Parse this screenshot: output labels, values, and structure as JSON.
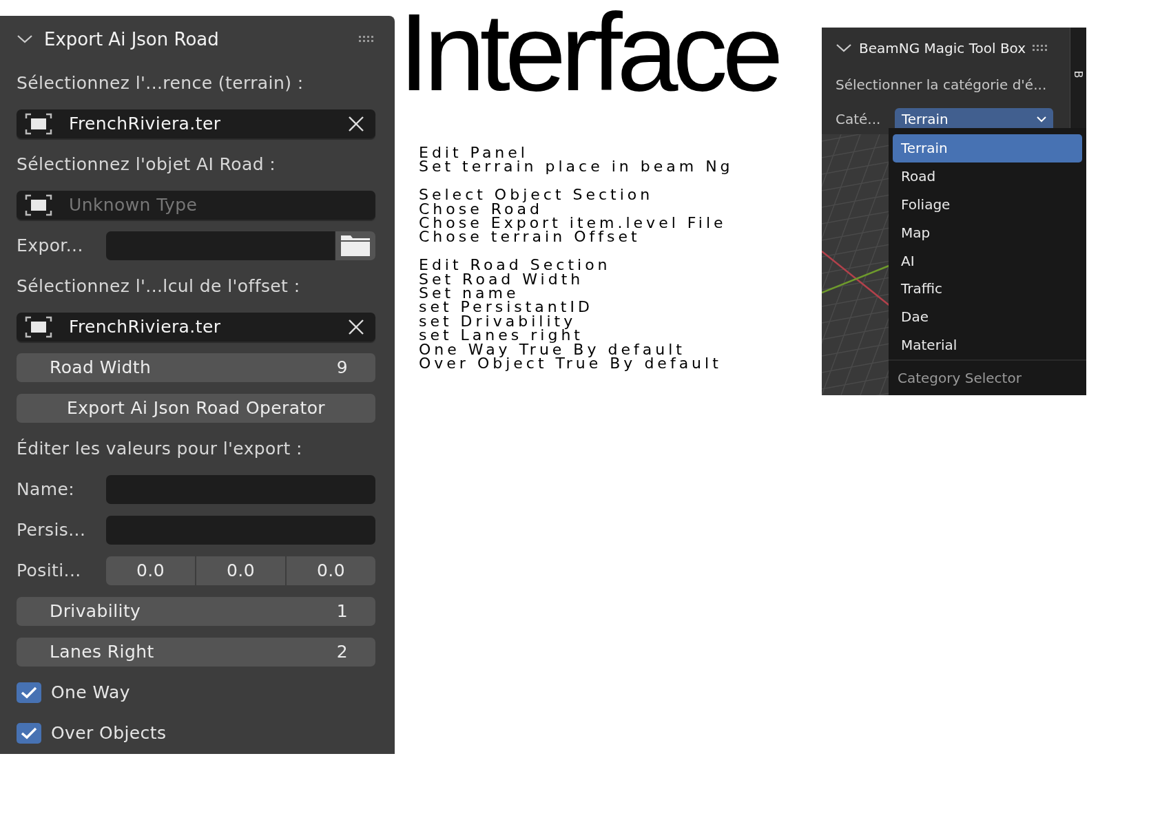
{
  "left_panel": {
    "title": "Export Ai Json Road",
    "rows": [
      {
        "kind": "label",
        "text": "Sélectionnez l'...rence (terrain) :"
      },
      {
        "kind": "object_field",
        "value": "FrenchRiviera.ter"
      },
      {
        "kind": "label",
        "text": "Sélectionnez l'objet AI Road :"
      },
      {
        "kind": "object_field",
        "placeholder": "Unknown Type"
      },
      {
        "kind": "path_field",
        "label": "Expor..."
      },
      {
        "kind": "label",
        "text": "Sélectionnez l'...lcul de l'offset :"
      },
      {
        "kind": "object_field",
        "value": "FrenchRiviera.ter"
      },
      {
        "kind": "number",
        "label": "Road Width",
        "value": "9"
      },
      {
        "kind": "button",
        "label": "Export Ai Json Road Operator"
      },
      {
        "kind": "label",
        "text": "Éditer les valeurs pour l'export :"
      },
      {
        "kind": "text_field",
        "label": "Name:"
      },
      {
        "kind": "text_field",
        "label": "Persis..."
      },
      {
        "kind": "vector",
        "label": "Positi...",
        "values": [
          "0.0",
          "0.0",
          "0.0"
        ]
      },
      {
        "kind": "number",
        "label": "Drivability",
        "value": "1"
      },
      {
        "kind": "number",
        "label": "Lanes Right",
        "value": "2"
      },
      {
        "kind": "checkbox",
        "label": "One Way",
        "checked": true
      },
      {
        "kind": "checkbox",
        "label": "Over Objects",
        "checked": true
      }
    ]
  },
  "heading": "Interface",
  "notes": [
    {
      "lines": [
        "Edit Panel",
        "Set terrain place in beam Ng"
      ]
    },
    {
      "lines": [
        "Select Object Section",
        "Chose Road",
        "Chose Export item.level File",
        "Chose terrain Offset"
      ]
    },
    {
      "lines": [
        "Edit Road Section",
        "Set Road Width",
        "Set name",
        "set PersistantID",
        "set Drivability",
        "set Lanes right",
        "One Way True By default",
        "Over Object True By default"
      ]
    }
  ],
  "right_panel": {
    "title": "BeamNG Magic Tool Box",
    "label": "Sélectionner la catégorie d'é...",
    "category": {
      "label": "Caté...",
      "value": "Terrain"
    },
    "sidebar_tab": "B",
    "menu": {
      "items": [
        {
          "label": "Terrain",
          "selected": true
        },
        {
          "label": "Road",
          "selected": false
        },
        {
          "label": "Foliage",
          "selected": false
        },
        {
          "label": "Map",
          "selected": false
        },
        {
          "label": "AI",
          "selected": false
        },
        {
          "label": "Traffic",
          "selected": false
        },
        {
          "label": "Dae",
          "selected": false
        },
        {
          "label": "Material",
          "selected": false
        }
      ],
      "footer": "Category Selector"
    }
  }
}
